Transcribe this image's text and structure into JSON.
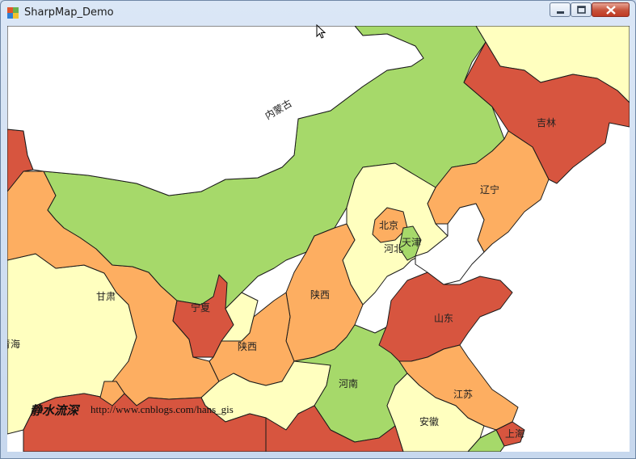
{
  "window": {
    "title": "SharpMap_Demo",
    "controls": [
      "minimize",
      "maximize",
      "close"
    ]
  },
  "map": {
    "colors": {
      "green": "#a6d96a",
      "pale": "#ffffbf",
      "orange": "#fdae61",
      "red": "#d7553f",
      "water": "#ffffff"
    },
    "labels": {
      "neimenggu": "内蒙古",
      "jilin": "吉林",
      "liaoning": "辽宁",
      "beijing": "北京",
      "tianjin": "天津",
      "hebei": "河北",
      "gansu": "甘肃",
      "ningxia": "宁夏",
      "shaanxi_a": "陕西",
      "shaanxi_b": "陕西",
      "qinghai": "青海",
      "shandong": "山东",
      "henan": "河南",
      "jiangsu": "江苏",
      "anhui": "安徽",
      "shanghai": "上海"
    }
  },
  "watermark": {
    "author": "静水流深",
    "url": "http://www.cnblogs.com/hans_gis"
  }
}
